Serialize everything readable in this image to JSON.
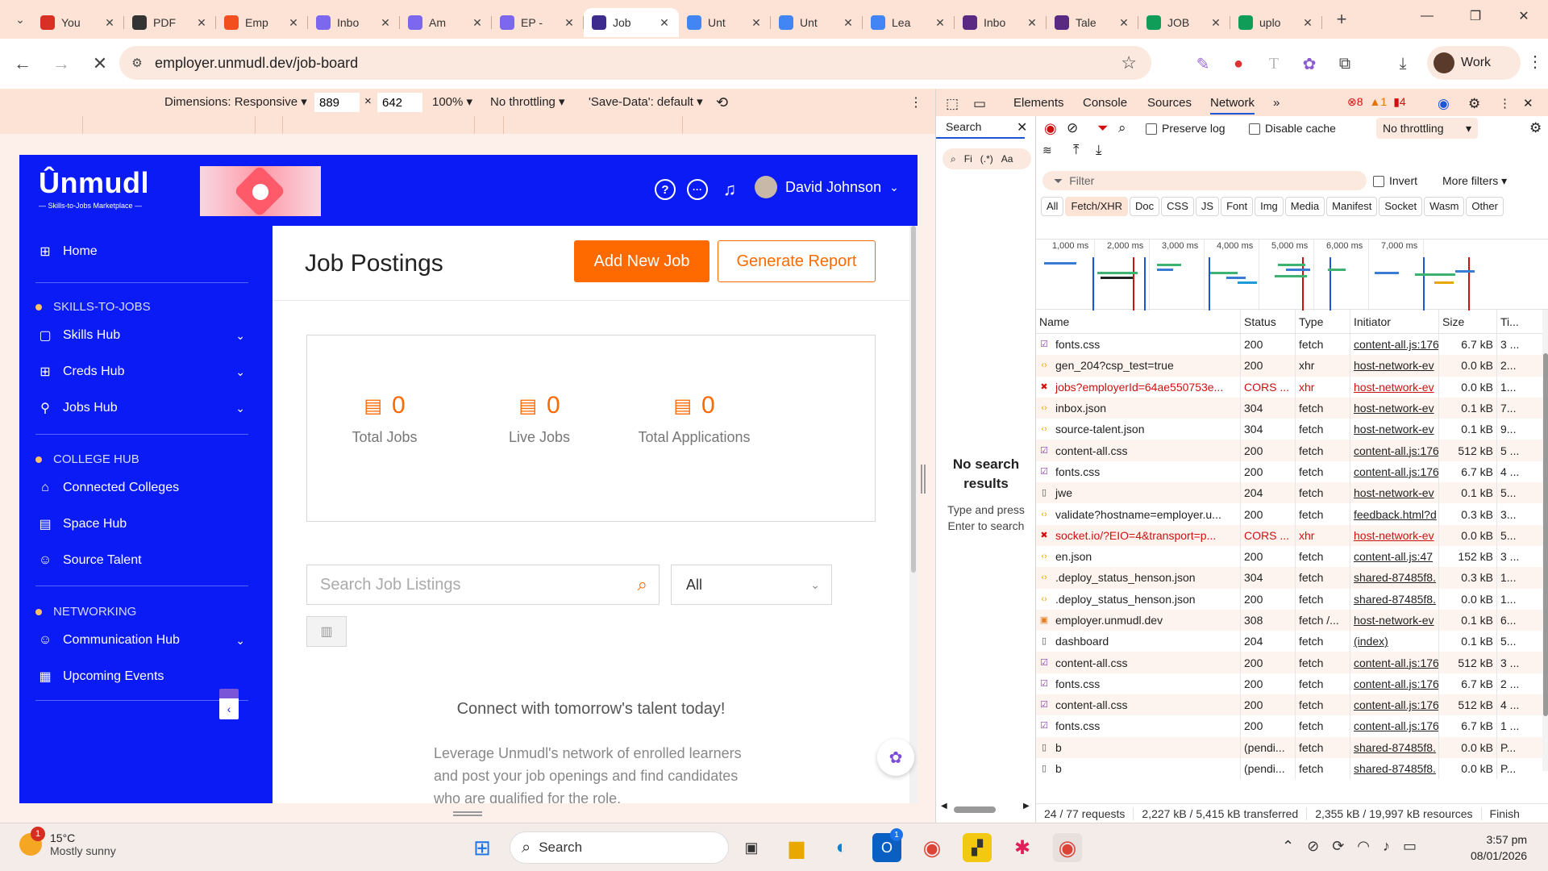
{
  "browser": {
    "tabs": [
      {
        "title": "You",
        "favicon": "gmail",
        "color": "#d93025"
      },
      {
        "title": "PDF",
        "favicon": "openai",
        "color": "#333333"
      },
      {
        "title": "Emp",
        "favicon": "figma",
        "color": "#f24e1e"
      },
      {
        "title": "Inbo",
        "favicon": "clickup",
        "color": "#7b68ee"
      },
      {
        "title": "Am",
        "favicon": "clickup",
        "color": "#7b68ee"
      },
      {
        "title": "EP -",
        "favicon": "clickup",
        "color": "#7b68ee"
      },
      {
        "title": "Job",
        "favicon": "unmudl",
        "color": "#3d2c8d",
        "active": true
      },
      {
        "title": "Unt",
        "favicon": "docs",
        "color": "#4285f4"
      },
      {
        "title": "Unt",
        "favicon": "docs",
        "color": "#4285f4"
      },
      {
        "title": "Lea",
        "favicon": "docs",
        "color": "#4285f4"
      },
      {
        "title": "Inbo",
        "favicon": "unmudl",
        "color": "#5a2a82"
      },
      {
        "title": "Tale",
        "favicon": "unmudl",
        "color": "#5a2a82"
      },
      {
        "title": "JOB",
        "favicon": "sheets",
        "color": "#0f9d58"
      },
      {
        "title": "uplo",
        "favicon": "sheets",
        "color": "#0f9d58"
      }
    ],
    "url": "employer.unmudl.dev/job-board",
    "profile_label": "Work"
  },
  "device_toolbar": {
    "dimensions_label": "Dimensions: Responsive",
    "width": "889",
    "times": "×",
    "height": "642",
    "zoom": "100%",
    "throttling": "No throttling",
    "save_data": "'Save-Data': default"
  },
  "app": {
    "logo": "Ûnmudl",
    "logo_tagline": "— Skills-to-Jobs Marketplace —",
    "user_name": "David Johnson",
    "sidebar": {
      "home": "Home",
      "section1": "SKILLS-TO-JOBS",
      "skills_hub": "Skills Hub",
      "creds_hub": "Creds Hub",
      "jobs_hub": "Jobs Hub",
      "section2": "COLLEGE HUB",
      "connected_colleges": "Connected Colleges",
      "space_hub": "Space Hub",
      "source_talent": "Source Talent",
      "section3": "NETWORKING",
      "communication_hub": "Communication Hub",
      "upcoming_events": "Upcoming Events"
    },
    "page_title": "Job Postings",
    "add_job_label": "Add New Job",
    "generate_report_label": "Generate Report",
    "stats": [
      {
        "value": "0",
        "label": "Total Jobs"
      },
      {
        "value": "0",
        "label": "Live Jobs"
      },
      {
        "value": "0",
        "label": "Total Applications"
      }
    ],
    "search_placeholder": "Search Job Listings",
    "filter_value": "All",
    "cta_title": "Connect with tomorrow's talent today!",
    "cta_body": "Leverage Unmudl's network of enrolled learners and post your job openings and find candidates who are qualified for the role."
  },
  "devtools": {
    "tabs": [
      "Elements",
      "Console",
      "Sources",
      "Network"
    ],
    "active_tab": "Network",
    "errors": "8",
    "warnings": "1",
    "issues": "4",
    "search_tab": "Search",
    "search_field": "Fi",
    "search_regex": "(.*)",
    "search_case": "Aa",
    "no_results_title": "No search results",
    "no_results_sub": "Type and press Enter to search",
    "preserve_log": "Preserve log",
    "disable_cache": "Disable cache",
    "throttling": "No throttling",
    "filter_placeholder": "Filter",
    "invert": "Invert",
    "more_filters": "More filters",
    "chips": [
      "All",
      "Fetch/XHR",
      "Doc",
      "CSS",
      "JS",
      "Font",
      "Img",
      "Media",
      "Manifest",
      "Socket",
      "Wasm",
      "Other"
    ],
    "active_chip": "Fetch/XHR",
    "timeline_ticks": [
      "1,000 ms",
      "2,000 ms",
      "3,000 ms",
      "4,000 ms",
      "5,000 ms",
      "6,000 ms",
      "7,000 ms"
    ],
    "columns": [
      "Name",
      "Status",
      "Type",
      "Initiator",
      "Size",
      "Ti..."
    ],
    "requests": [
      {
        "name": "fonts.css",
        "status": "200",
        "type": "fetch",
        "initiator": "content-all.js:176",
        "size": "6.7 kB",
        "time": "3 ...",
        "icon": "css"
      },
      {
        "name": "gen_204?csp_test=true",
        "status": "200",
        "type": "xhr",
        "initiator": "host-network-ev",
        "size": "0.0 kB",
        "time": "2...",
        "icon": "js"
      },
      {
        "name": "jobs?employerId=64ae550753e...",
        "status": "CORS ...",
        "type": "xhr",
        "initiator": "host-network-ev",
        "size": "0.0 kB",
        "time": "1...",
        "icon": "error",
        "error": true
      },
      {
        "name": "inbox.json",
        "status": "304",
        "type": "fetch",
        "initiator": "host-network-ev",
        "size": "0.1 kB",
        "time": "7...",
        "icon": "js"
      },
      {
        "name": "source-talent.json",
        "status": "304",
        "type": "fetch",
        "initiator": "host-network-ev",
        "size": "0.1 kB",
        "time": "9...",
        "icon": "js"
      },
      {
        "name": "content-all.css",
        "status": "200",
        "type": "fetch",
        "initiator": "content-all.js:176",
        "size": "512 kB",
        "time": "5 ...",
        "icon": "css"
      },
      {
        "name": "fonts.css",
        "status": "200",
        "type": "fetch",
        "initiator": "content-all.js:176",
        "size": "6.7 kB",
        "time": "4 ...",
        "icon": "css"
      },
      {
        "name": "jwe",
        "status": "204",
        "type": "fetch",
        "initiator": "host-network-ev",
        "size": "0.1 kB",
        "time": "5...",
        "icon": "doc"
      },
      {
        "name": "validate?hostname=employer.u...",
        "status": "200",
        "type": "fetch",
        "initiator": "feedback.html?d",
        "size": "0.3 kB",
        "time": "3...",
        "icon": "js"
      },
      {
        "name": "socket.io/?EIO=4&transport=p...",
        "status": "CORS ...",
        "type": "xhr",
        "initiator": "host-network-ev",
        "size": "0.0 kB",
        "time": "5...",
        "icon": "error",
        "error": true
      },
      {
        "name": "en.json",
        "status": "200",
        "type": "fetch",
        "initiator": "content-all.js:47",
        "size": "152 kB",
        "time": "3 ...",
        "icon": "js"
      },
      {
        "name": ".deploy_status_henson.json",
        "status": "304",
        "type": "fetch",
        "initiator": "shared-87485f8.",
        "size": "0.3 kB",
        "time": "1...",
        "icon": "js"
      },
      {
        "name": ".deploy_status_henson.json",
        "status": "200",
        "type": "fetch",
        "initiator": "shared-87485f8.",
        "size": "0.0 kB",
        "time": "1...",
        "icon": "js"
      },
      {
        "name": "employer.unmudl.dev",
        "status": "308",
        "type": "fetch /...",
        "initiator": "host-network-ev",
        "size": "0.1 kB",
        "time": "6...",
        "icon": "html"
      },
      {
        "name": "dashboard",
        "status": "204",
        "type": "fetch",
        "initiator": "(index)",
        "size": "0.1 kB",
        "time": "5...",
        "icon": "doc"
      },
      {
        "name": "content-all.css",
        "status": "200",
        "type": "fetch",
        "initiator": "content-all.js:176",
        "size": "512 kB",
        "time": "3 ...",
        "icon": "css"
      },
      {
        "name": "fonts.css",
        "status": "200",
        "type": "fetch",
        "initiator": "content-all.js:176",
        "size": "6.7 kB",
        "time": "2 ...",
        "icon": "css"
      },
      {
        "name": "content-all.css",
        "status": "200",
        "type": "fetch",
        "initiator": "content-all.js:176",
        "size": "512 kB",
        "time": "4 ...",
        "icon": "css"
      },
      {
        "name": "fonts.css",
        "status": "200",
        "type": "fetch",
        "initiator": "content-all.js:176",
        "size": "6.7 kB",
        "time": "1 ...",
        "icon": "css"
      },
      {
        "name": "b",
        "status": "(pendi...",
        "type": "fetch",
        "initiator": "shared-87485f8.",
        "size": "0.0 kB",
        "time": "P...",
        "icon": "doc"
      },
      {
        "name": "b",
        "status": "(pendi...",
        "type": "fetch",
        "initiator": "shared-87485f8.",
        "size": "0.0 kB",
        "time": "P...",
        "icon": "doc"
      }
    ],
    "summary_requests": "24 / 77 requests",
    "summary_transferred": "2,227 kB / 5,415 kB transferred",
    "summary_resources": "2,355 kB / 19,997 kB resources",
    "summary_finish": "Finish"
  },
  "taskbar": {
    "weather_temp": "15°C",
    "weather_desc": "Mostly sunny",
    "weather_badge": "1",
    "search_label": "Search",
    "time": "3:57 pm",
    "date": "08/01/2026",
    "outlook_badge": "1"
  }
}
